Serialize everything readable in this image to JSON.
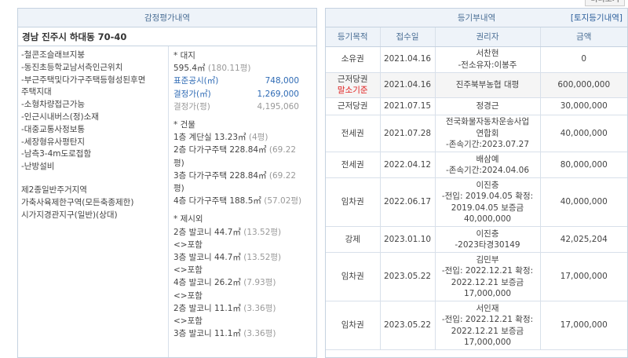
{
  "top_link": "미리보기",
  "left": {
    "title": "감정평가내역",
    "address": "경남 진주시 하대동 70-40",
    "features": [
      "-철콘조슬래브지붕",
      "-동진초등학교남서측인근위치",
      "-부근주택및다가구주택등형성된후면",
      "주택지대",
      "-소형차량접근가능",
      "-인근시내버스(정)소재",
      "-대중교통사정보통",
      "-세장형유사평탄지",
      "-남측3-4m도로접함",
      "-난방설비"
    ],
    "zoning": [
      "제2종일반주거지역",
      "가축사육제한구역(모든축종제한)",
      "시가지경관지구(일반)(상대)"
    ],
    "land": {
      "heading": "* 대지",
      "area": "595.4㎡",
      "area_pyeong": "(180.11평)",
      "official_label": "표준공시(㎡)",
      "official_value": "748,000",
      "decided_label": "결정가(㎡)",
      "decided_value": "1,269,000",
      "decided_pyeong_label": "결정가(평)",
      "decided_pyeong_value": "4,195,060"
    },
    "building": {
      "heading": "* 건물",
      "lines": [
        {
          "text": "1층 계단실 13.23㎡",
          "sub": "(4평)"
        },
        {
          "text": "2층 다가구주택 228.84㎡",
          "sub": "(69.22"
        },
        {
          "text": "평)",
          "sub": ""
        },
        {
          "text": "3층 다가구주택 228.84㎡",
          "sub": "(69.22"
        },
        {
          "text": "평)",
          "sub": ""
        },
        {
          "text": "4층 다가구주택 188.5㎡",
          "sub": "(57.02평)"
        }
      ]
    },
    "extra": {
      "heading": "* 제시외",
      "lines": [
        {
          "text": "2층 발코니 44.7㎡",
          "sub": "(13.52평)"
        },
        {
          "text": "<>포함",
          "sub": ""
        },
        {
          "text": "3층 발코니 44.7㎡",
          "sub": "(13.52평)"
        },
        {
          "text": "<>포함",
          "sub": ""
        },
        {
          "text": "4층 발코니 26.2㎡",
          "sub": "(7.93평)"
        },
        {
          "text": "<>포함",
          "sub": ""
        },
        {
          "text": "2층 발코니 11.1㎡",
          "sub": "(3.36평)"
        },
        {
          "text": "<>포함",
          "sub": ""
        },
        {
          "text": "3층 발코니 11.1㎡",
          "sub": "(3.36평)"
        }
      ]
    }
  },
  "right": {
    "title": "등기부내역",
    "link": "[토지등기내역]",
    "columns": [
      "등기목적",
      "접수일",
      "권리자",
      "금액"
    ],
    "rows": [
      {
        "purpose": "소유권",
        "purpose_note": "",
        "date": "2021.04.16",
        "holder": [
          "서찬현",
          "-전소유자:이봉주"
        ],
        "amount": "0",
        "style": ""
      },
      {
        "purpose": "근저당권",
        "purpose_note": "말소기준",
        "date": "2021.04.16",
        "holder": [
          "진주북부농협 대평"
        ],
        "amount": "600,000,000",
        "style": "gray"
      },
      {
        "purpose": "근저당권",
        "purpose_note": "",
        "date": "2021.07.15",
        "holder": [
          "정경근"
        ],
        "amount": "30,000,000",
        "style": ""
      },
      {
        "purpose": "전세권",
        "purpose_note": "",
        "date": "2021.07.28",
        "holder": [
          "전국화물자동차운송사업",
          "연합회",
          "-존속기간:2023.07.27"
        ],
        "amount": "40,000,000",
        "style": ""
      },
      {
        "purpose": "전세권",
        "purpose_note": "",
        "date": "2022.04.12",
        "holder": [
          "배삼예",
          "-존속기간:2024.04.06"
        ],
        "amount": "80,000,000",
        "style": ""
      },
      {
        "purpose": "임차권",
        "purpose_note": "",
        "date": "2022.06.17",
        "holder": [
          "이진충",
          "-전입: 2019.04.05 확정:",
          "2019.04.05 보증금",
          "40,000,000"
        ],
        "amount": "40,000,000",
        "style": ""
      },
      {
        "purpose": "강제",
        "purpose_note": "",
        "date": "2023.01.10",
        "holder": [
          "이진충",
          "-2023타경30149"
        ],
        "amount": "42,025,204",
        "style": "forced"
      },
      {
        "purpose": "임차권",
        "purpose_note": "",
        "date": "2023.05.22",
        "holder": [
          "김민부",
          "-전입: 2022.12.21 확정:",
          "2022.12.21 보증금",
          "17,000,000"
        ],
        "amount": "17,000,000",
        "style": ""
      },
      {
        "purpose": "임차권",
        "purpose_note": "",
        "date": "2023.05.22",
        "holder": [
          "서인재",
          "-전입: 2022.12.21 확정:",
          "2022.12.21 보증금",
          "17,000,000"
        ],
        "amount": "17,000,000",
        "style": ""
      }
    ]
  }
}
